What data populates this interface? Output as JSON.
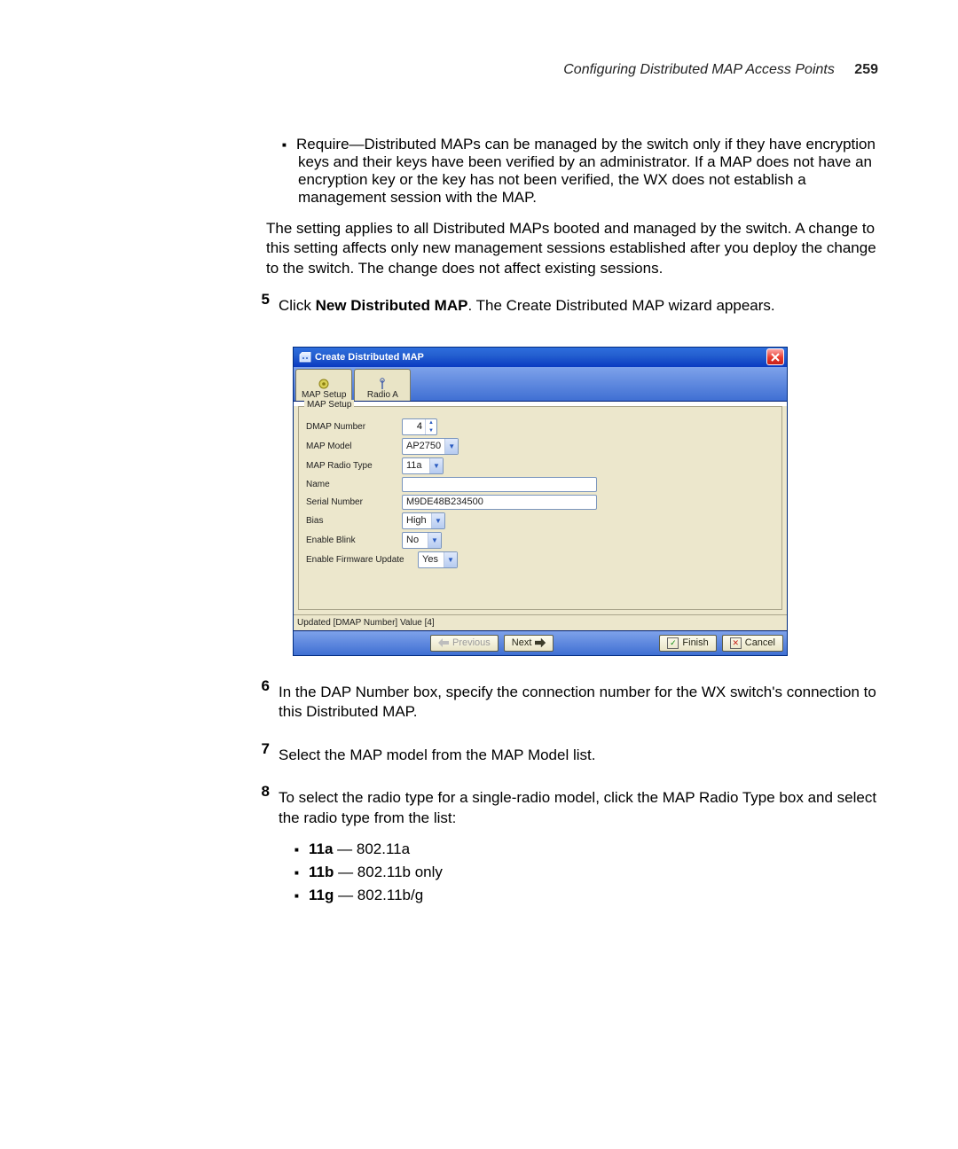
{
  "header": {
    "title": "Configuring Distributed MAP Access Points",
    "page": "259"
  },
  "bullet_require": "Require—Distributed MAPs can be managed by the switch only if they have encryption keys and their keys have been verified by an administrator. If a MAP does not have an encryption key or the key has not been verified, the WX does not establish a management session with the MAP.",
  "para_setting": "The setting applies to all Distributed MAPs booted and managed by the switch. A change to this setting affects only new management sessions established after you deploy the change to the switch. The change does not affect existing sessions.",
  "step5": {
    "num": "5",
    "pre": "Click ",
    "bold": "New Distributed MAP",
    "post": ". The Create Distributed MAP wizard appears."
  },
  "wizard": {
    "title": "Create Distributed MAP",
    "tabs": {
      "setup": "MAP Setup",
      "radio": "Radio A"
    },
    "fieldset_legend": "MAP Setup",
    "fields": {
      "dmap_number": {
        "label": "DMAP Number",
        "value": "4"
      },
      "map_model": {
        "label": "MAP Model",
        "value": "AP2750"
      },
      "radio_type": {
        "label": "MAP Radio Type",
        "value": "11a"
      },
      "name": {
        "label": "Name",
        "value": ""
      },
      "serial": {
        "label": "Serial Number",
        "value": "M9DE48B234500"
      },
      "bias": {
        "label": "Bias",
        "value": "High"
      },
      "blink": {
        "label": "Enable Blink",
        "value": "No"
      },
      "firmware": {
        "label": "Enable Firmware Update",
        "value": "Yes"
      }
    },
    "status": "Updated [DMAP Number] Value [4]",
    "buttons": {
      "previous": "Previous",
      "next": "Next",
      "finish": "Finish",
      "cancel": "Cancel"
    }
  },
  "step6": {
    "num": "6",
    "text": "In the DAP Number box, specify the connection number for the WX switch's connection to this Distributed MAP."
  },
  "step7": {
    "num": "7",
    "text": "Select the MAP model from the MAP Model list."
  },
  "step8": {
    "num": "8",
    "text": "To select the radio type for a single-radio model, click the MAP Radio Type box and select the radio type from the list:"
  },
  "radios": {
    "a": {
      "bold": "11a",
      "rest": " — 802.11a"
    },
    "b": {
      "bold": "11b",
      "rest": " — 802.11b only"
    },
    "g": {
      "bold": "11g",
      "rest": " — 802.11b/g"
    }
  }
}
